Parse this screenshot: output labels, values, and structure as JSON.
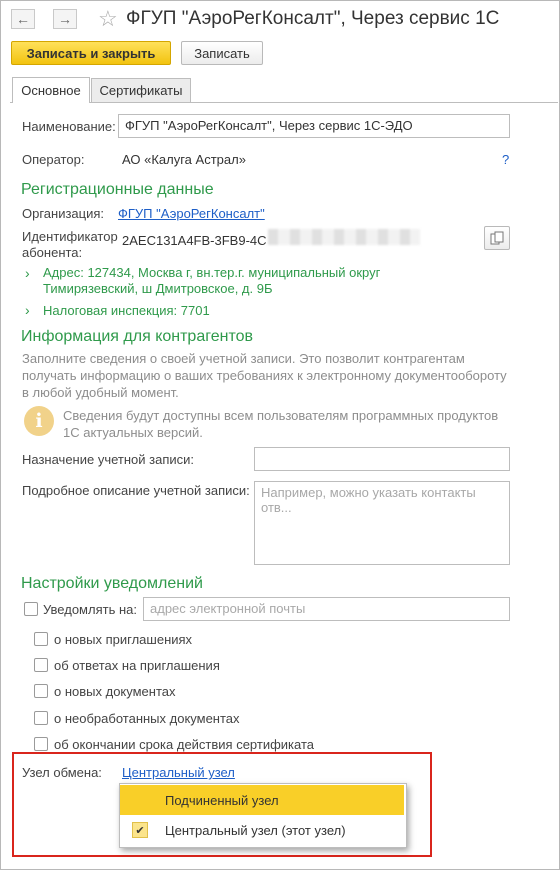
{
  "window": {
    "title": "ФГУП \"АэроРегКонсалт\", Через сервис 1С",
    "back_icon": "←",
    "forward_icon": "→",
    "star_icon": "☆"
  },
  "toolbar": {
    "save_close_label": "Записать и закрыть",
    "save_label": "Записать"
  },
  "tabs": [
    {
      "label": "Основное",
      "active": true
    },
    {
      "label": "Сертификаты",
      "active": false
    }
  ],
  "form": {
    "name_label": "Наименование:",
    "name_value": "ФГУП \"АэроРегКонсалт\", Через сервис 1С-ЭДО",
    "operator_label": "Оператор:",
    "operator_value": "АО «Калуга Астрал»",
    "help_label": "?"
  },
  "registration": {
    "heading": "Регистрационные данные",
    "org_label": "Организация:",
    "org_value": "ФГУП \"АэроРегКонсалт\"",
    "id_label_line1": "Идентификатор",
    "id_label_line2": "абонента:",
    "id_value": "2AEC131A4FB-3FB9-4C",
    "copy_icon": "copy-icon",
    "address_line1": "Адрес: 127434, Москва г, вн.тер.г. муниципальный округ",
    "address_line2": "Тимирязевский, ш Дмитровское, д. 9Б",
    "tax_inspection": "Налоговая инспекция: 7701"
  },
  "counterparty_info": {
    "heading": "Информация для контрагентов",
    "description_line1": "Заполните сведения о своей учетной записи. Это позволит контрагентам",
    "description_line2": "получать информацию о ваших требованиях к электронному документообороту",
    "description_line3": "в любой удобный момент.",
    "info_line1": "Сведения будут доступны всем пользователям программных продуктов",
    "info_line2": "1С актуальных версий.",
    "purpose_label": "Назначение учетной записи:",
    "purpose_value": "",
    "detail_label": "Подробное описание учетной записи:",
    "detail_placeholder": "Например, можно указать контакты отв..."
  },
  "notifications": {
    "heading": "Настройки уведомлений",
    "notify_label": "Уведомлять на:",
    "email_placeholder": "адрес электронной почты",
    "options": [
      "о новых приглашениях",
      "об ответах на приглашения",
      "о новых документах",
      "о необработанных документах",
      "об окончании срока действия сертификата"
    ]
  },
  "exchange_node": {
    "label": "Узел обмена:",
    "value": "Центральный узел",
    "dropdown_options": [
      {
        "label": "Подчиненный узел",
        "highlighted": true,
        "checked": false
      },
      {
        "label": "Центральный узел (этот узел)",
        "highlighted": false,
        "checked": true
      }
    ],
    "check_glyph": "✔"
  },
  "colors": {
    "accent_green": "#2f9a4b",
    "link_blue": "#1d5ec7",
    "primary_yellow": "#f2c310",
    "highlight_red": "#d9251c"
  }
}
